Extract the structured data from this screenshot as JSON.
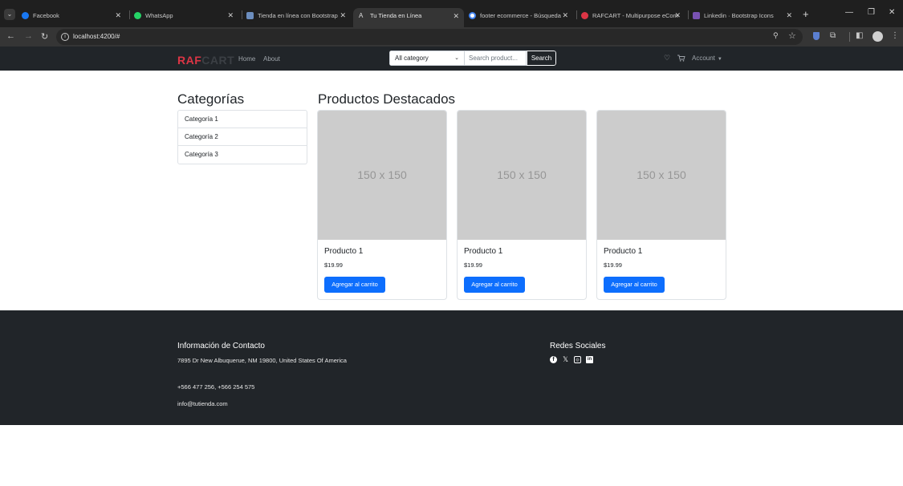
{
  "browser": {
    "tabs": [
      {
        "title": "Facebook",
        "favicon_color": "#1877f2"
      },
      {
        "title": "WhatsApp",
        "favicon_color": "#25d366"
      },
      {
        "title": "Tienda en línea con Bootstrap",
        "favicon_color": "#6c8ebf"
      },
      {
        "title": "Tu Tienda en Línea",
        "favicon_color": "#dddddd"
      },
      {
        "title": "footer ecommerce - Búsqueda",
        "favicon_color": "#ffffff"
      },
      {
        "title": "RAFCART - Multipurpose eCom",
        "favicon_color": "#dc3545"
      },
      {
        "title": "Linkedin · Bootstrap Icons",
        "favicon_color": "#7952b3"
      }
    ],
    "active_tab_index": 3,
    "url": "localhost:4200/#"
  },
  "navbar": {
    "brand_part1": "RAF",
    "brand_part2": "CART",
    "links": [
      "Home",
      "About"
    ],
    "category_select": "All category",
    "search_placeholder": "Search product...",
    "search_button": "Search",
    "account_label": "Account"
  },
  "sidebar": {
    "title": "Categorías",
    "categories": [
      "Categoría 1",
      "Categoría 2",
      "Categoría 3"
    ]
  },
  "products": {
    "title": "Productos Destacados",
    "placeholder_text": "150 x 150",
    "items": [
      {
        "name": "Producto 1",
        "price": "$19.99",
        "button": "Agregar al carrito"
      },
      {
        "name": "Producto 1",
        "price": "$19.99",
        "button": "Agregar al carrito"
      },
      {
        "name": "Producto 1",
        "price": "$19.99",
        "button": "Agregar al carrito"
      }
    ]
  },
  "footer": {
    "contact_title": "Información de Contacto",
    "address": "7895 Dr New Albuquerue, NM 19800, United States Of America",
    "phones": "+566 477 256, +566 254 575",
    "email": "info@tutienda.com",
    "social_title": "Redes Sociales",
    "social_icons": [
      "facebook-icon",
      "x-twitter-icon",
      "instagram-icon",
      "linkedin-icon"
    ]
  },
  "colors": {
    "brand_red": "#dc3545",
    "navbar_bg": "#212529",
    "primary_button": "#0d6efd"
  }
}
